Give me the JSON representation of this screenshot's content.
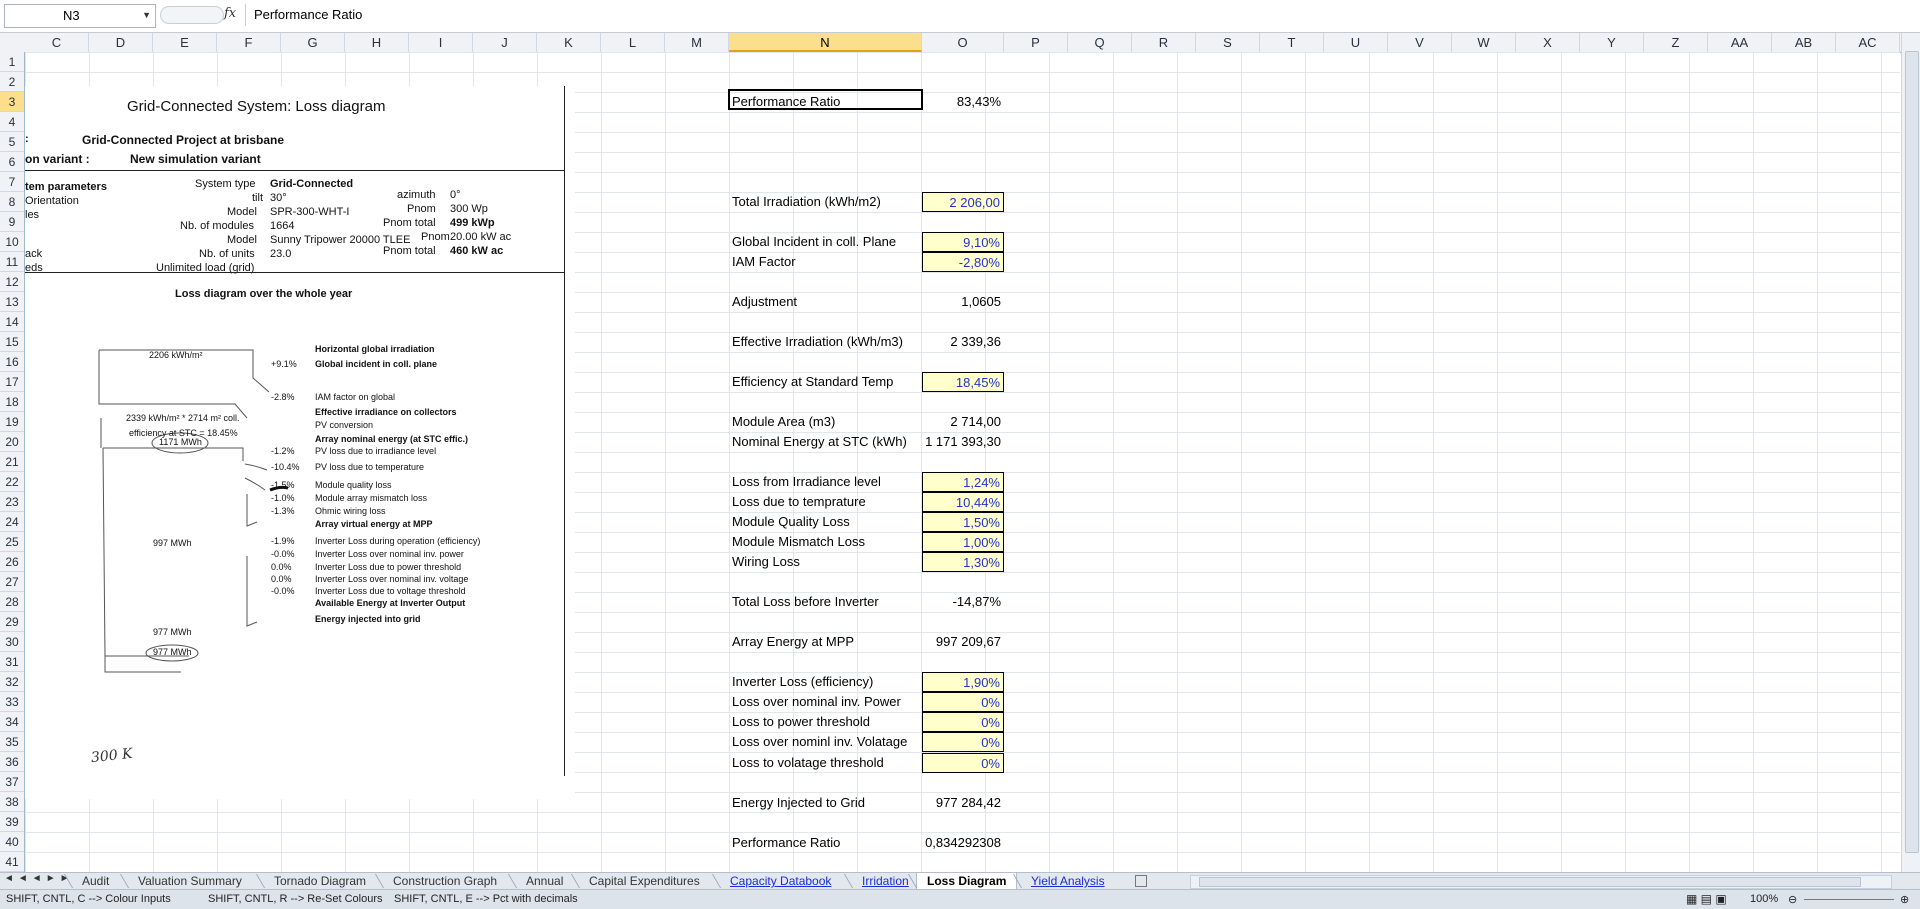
{
  "formula_bar": {
    "name_box": "N3",
    "fx_icon": "fx",
    "formula": "Performance Ratio"
  },
  "columns": [
    "C",
    "D",
    "E",
    "F",
    "G",
    "H",
    "I",
    "J",
    "K",
    "L",
    "M",
    "N",
    "O",
    "P",
    "Q",
    "R",
    "S",
    "T",
    "U",
    "V",
    "W",
    "X",
    "Y",
    "Z",
    "AA",
    "AB",
    "AC"
  ],
  "selected_column": "N",
  "rows": [
    "1",
    "2",
    "3",
    "4",
    "5",
    "6",
    "7",
    "8",
    "9",
    "10",
    "11",
    "12",
    "13",
    "14",
    "15",
    "16",
    "17",
    "18",
    "19",
    "20",
    "21",
    "22",
    "23",
    "24",
    "25",
    "26",
    "27",
    "28",
    "29",
    "30",
    "31",
    "32",
    "33",
    "34",
    "35",
    "36",
    "37",
    "38",
    "39",
    "40",
    "41"
  ],
  "selected_row": "3",
  "scan": {
    "title": "Grid-Connected System: Loss diagram",
    "project_label": ":",
    "project": "Grid-Connected Project at brisbane",
    "variant_label": "on variant  :",
    "variant": "New simulation variant",
    "params_left": [
      "tem parameters",
      "Orientation",
      "les",
      "ack",
      "eds"
    ],
    "system_type_label": "System type",
    "system_type": "Grid-Connected",
    "tilt_label": "tilt",
    "tilt": "30°",
    "azimuth_label": "azimuth",
    "azimuth": "0°",
    "model_label": "Model",
    "model": "SPR-300-WHT-I",
    "pnom_label": "Pnom",
    "pnom": "300 Wp",
    "nb_modules_label": "Nb. of modules",
    "nb_modules": "1664",
    "pnom_total_label": "Pnom total",
    "pnom_total": "499 kWp",
    "inv_model_label": "Model",
    "inv_model": "Sunny Tripower 20000 TLEE",
    "inv_pnom_label": "Pnom",
    "inv_pnom": "20.00 kW ac",
    "nb_units_label": "Nb. of units",
    "nb_units": "23.0",
    "inv_pnom_total_label": "Pnom total",
    "inv_pnom_total": "460 kW ac",
    "unlimited": "Unlimited load (grid)",
    "diagram_title": "Loss diagram over the whole year",
    "left_values": [
      "2206 kWh/m²",
      "2339 kWh/m² * 2714 m² coll.",
      "efficiency at STC = 18.45%",
      "1171 MWh",
      "997 MWh",
      "977 MWh",
      "977 MWh"
    ],
    "right_labels": [
      {
        "pct": "",
        "text": "Horizontal global irradiation",
        "bold": true
      },
      {
        "pct": "+9.1%",
        "text": "Global incident in coll. plane",
        "bold": true
      },
      {
        "pct": "-2.8%",
        "text": "IAM factor on global",
        "bold": false
      },
      {
        "pct": "",
        "text": "Effective irradiance on collectors",
        "bold": true
      },
      {
        "pct": "",
        "text": "PV conversion",
        "bold": false
      },
      {
        "pct": "",
        "text": "Array nominal energy (at STC effic.)",
        "bold": true
      },
      {
        "pct": "-1.2%",
        "text": "PV loss due to irradiance level",
        "bold": false
      },
      {
        "pct": "-10.4%",
        "text": "PV loss due to temperature",
        "bold": false
      },
      {
        "pct": "-1.5%",
        "text": "Module quality loss",
        "bold": false
      },
      {
        "pct": "-1.0%",
        "text": "Module array mismatch loss",
        "bold": false
      },
      {
        "pct": "-1.3%",
        "text": "Ohmic wiring loss",
        "bold": false
      },
      {
        "pct": "",
        "text": "Array virtual energy at MPP",
        "bold": true
      },
      {
        "pct": "-1.9%",
        "text": "Inverter Loss during operation (efficiency)",
        "bold": false
      },
      {
        "pct": "-0.0%",
        "text": "Inverter Loss over nominal inv. power",
        "bold": false
      },
      {
        "pct": "0.0%",
        "text": "Inverter Loss due to power threshold",
        "bold": false
      },
      {
        "pct": "0.0%",
        "text": "Inverter Loss over nominal inv. voltage",
        "bold": false
      },
      {
        "pct": "-0.0%",
        "text": "Inverter Loss due to voltage threshold",
        "bold": false
      },
      {
        "pct": "",
        "text": "Available Energy at Inverter Output",
        "bold": true
      },
      {
        "pct": "",
        "text": "Energy injected into grid",
        "bold": true
      }
    ],
    "handwriting": "300 K"
  },
  "cells": [
    {
      "row": 3,
      "label": "Performance Ratio",
      "value": "83,43%",
      "input": false
    },
    {
      "row": 8,
      "label": "Total Irradiation (kWh/m2)",
      "value": "2 206,00",
      "input": true
    },
    {
      "row": 10,
      "label": "Global Incident in coll. Plane",
      "value": "9,10%",
      "input": true
    },
    {
      "row": 11,
      "label": "IAM Factor",
      "value": "-2,80%",
      "input": true
    },
    {
      "row": 13,
      "label": "Adjustment",
      "value": "1,0605",
      "input": false
    },
    {
      "row": 15,
      "label": "Effective Irradiation (kWh/m3)",
      "value": "2 339,36",
      "input": false
    },
    {
      "row": 17,
      "label": "Efficiency at Standard Temp",
      "value": "18,45%",
      "input": true
    },
    {
      "row": 19,
      "label": "Module Area (m3)",
      "value": "2 714,00",
      "input": false
    },
    {
      "row": 20,
      "label": "Nominal Energy at STC (kWh)",
      "value": "1 171 393,30",
      "input": false
    },
    {
      "row": 22,
      "label": "Loss from Irradiance level",
      "value": "1,24%",
      "input": true
    },
    {
      "row": 23,
      "label": "Loss due to temprature",
      "value": "10,44%",
      "input": true
    },
    {
      "row": 24,
      "label": "Module Quality Loss",
      "value": "1,50%",
      "input": true
    },
    {
      "row": 25,
      "label": "Module Mismatch Loss",
      "value": "1,00%",
      "input": true
    },
    {
      "row": 26,
      "label": "Wiring Loss",
      "value": "1,30%",
      "input": true
    },
    {
      "row": 28,
      "label": "Total Loss before Inverter",
      "value": "-14,87%",
      "input": false
    },
    {
      "row": 30,
      "label": "Array Energy at MPP",
      "value": "997 209,67",
      "input": false
    },
    {
      "row": 32,
      "label": "Inverter Loss (efficiency)",
      "value": "1,90%",
      "input": true
    },
    {
      "row": 33,
      "label": "Loss over nominal inv. Power",
      "value": "0%",
      "input": true
    },
    {
      "row": 34,
      "label": "Loss to power threshold",
      "value": "0%",
      "input": true
    },
    {
      "row": 35,
      "label": "Loss over nominl inv. Volatage",
      "value": "0%",
      "input": true
    },
    {
      "row": 36,
      "label": "Loss to volatage threshold",
      "value": "0%",
      "input": true
    },
    {
      "row": 38,
      "label": "Energy Injected to Grid",
      "value": "977 284,42",
      "input": false
    },
    {
      "row": 40,
      "label": "Performance Ratio",
      "value": "0,834292308",
      "input": false
    }
  ],
  "tabs": [
    {
      "label": "Audit",
      "colored": false,
      "active": false
    },
    {
      "label": "Valuation Summary",
      "colored": false,
      "active": false
    },
    {
      "label": "Tornado Diagram",
      "colored": false,
      "active": false
    },
    {
      "label": "Construction Graph",
      "colored": false,
      "active": false
    },
    {
      "label": "Annual",
      "colored": false,
      "active": false
    },
    {
      "label": "Capital Expenditures",
      "colored": false,
      "active": false
    },
    {
      "label": "Capacity Databook",
      "colored": true,
      "active": false
    },
    {
      "label": "Irridation",
      "colored": true,
      "active": false
    },
    {
      "label": "Loss Diagram",
      "colored": false,
      "active": true
    },
    {
      "label": "Yield Analysis",
      "colored": true,
      "active": false
    }
  ],
  "status": {
    "hint1": "SHIFT, CNTL, C --> Colour Inputs",
    "hint2": "SHIFT, CNTL, R --> Re-Set Colours",
    "hint3": "SHIFT, CNTL, E --> Pct with decimals",
    "zoom": "100%"
  }
}
